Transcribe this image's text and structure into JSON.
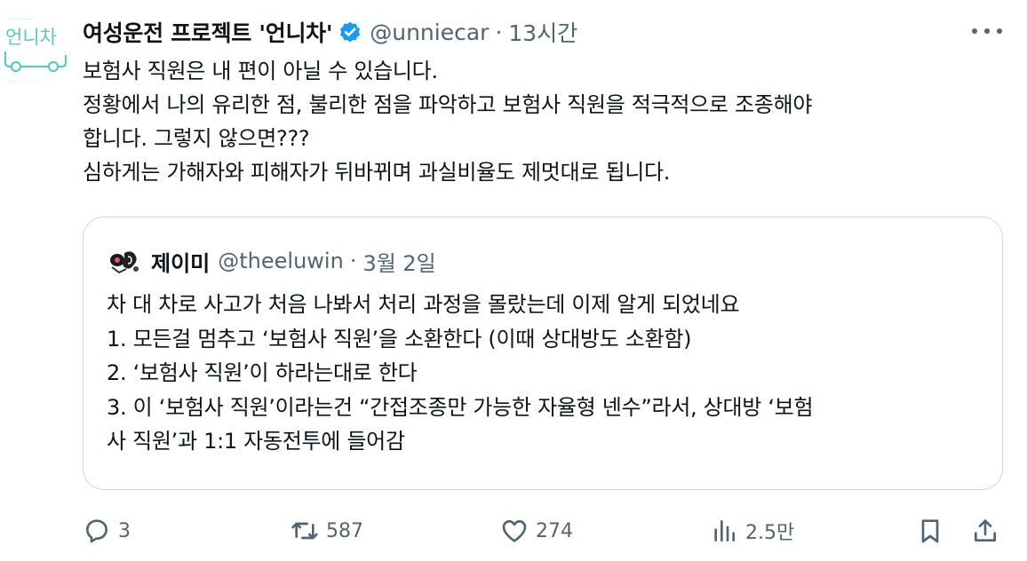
{
  "author": {
    "display_name": "여성운전 프로젝트 '언니차'",
    "handle": "@unniecar",
    "separator": "·",
    "time": "13시간",
    "verified": true,
    "avatar_logo_text": "언니차"
  },
  "tweet": {
    "lines": [
      "보험사 직원은 내 편이 아닐 수 있습니다.",
      "정황에서 나의 유리한 점, 불리한 점을 파악하고 보험사 직원을 적극적으로 조종해야",
      "합니다. 그렇지 않으면???",
      "심하게는 가해자와 피해자가 뒤바뀌며 과실비율도 제멋대로 됩니다."
    ]
  },
  "quote": {
    "display_name": "제이미",
    "handle": "@theeluwin",
    "separator": "·",
    "time": "3월 2일",
    "lines": [
      "차 대 차로 사고가 처음 나봐서 처리 과정을 몰랐는데 이제 알게 되었네요",
      "1. 모든걸 멈추고 ‘보험사 직원’을 소환한다 (이때 상대방도 소환함)",
      "2. ‘보험사 직원’이 하라는대로 한다",
      "3. 이 ‘보험사 직원’이라는건 “간접조종만 가능한 자율형 넨수”라서, 상대방 ‘보험",
      "사 직원’과 1:1 자동전투에 들어감"
    ]
  },
  "actions": {
    "reply_count": "3",
    "retweet_count": "587",
    "like_count": "274",
    "views_count": "2.5만"
  },
  "icons": {
    "verified": "verified-badge-icon",
    "more": "more-dots-icon",
    "reply": "reply-icon",
    "retweet": "retweet-icon",
    "like": "heart-icon",
    "views": "views-icon",
    "bookmark": "bookmark-icon",
    "share": "share-icon"
  },
  "colors": {
    "text_primary": "#0f1419",
    "text_secondary": "#536471",
    "verified_blue": "#1d9bf0",
    "border": "#cfd9de",
    "logo_teal": "#5fc9b5"
  }
}
